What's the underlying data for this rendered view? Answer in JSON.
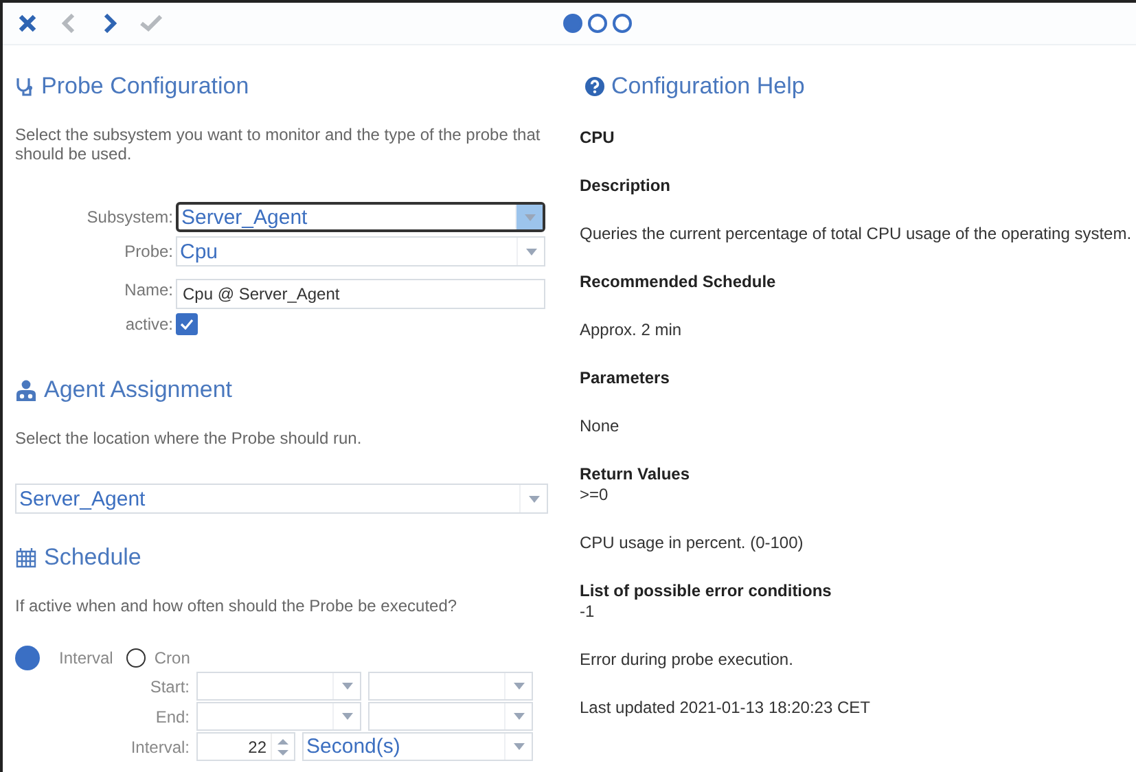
{
  "toolbar": [
    {
      "kind": "close",
      "disabled": false
    },
    {
      "kind": "back",
      "disabled": true
    },
    {
      "kind": "forward",
      "disabled": false
    },
    {
      "kind": "finish",
      "disabled": true
    }
  ],
  "steps": [
    {
      "selected": true
    },
    {
      "selected": false
    },
    {
      "selected": false
    }
  ],
  "probe_configuration": {
    "title": "Probe Configuration",
    "description": "Select the subsystem you want to monitor and the type of the probe that should be used.",
    "fields": [
      {
        "kind": "select",
        "label": "Subsystem:",
        "value": "Server_Agent",
        "focused": true
      },
      {
        "kind": "select",
        "label": "Probe:",
        "value": "Cpu",
        "focused": false
      },
      {
        "kind": "text",
        "label": "Name:",
        "value": "Cpu @ Server_Agent"
      },
      {
        "kind": "checkbox",
        "label": "active:",
        "checked": true
      }
    ]
  },
  "agent_assignment": {
    "title": "Agent Assignment",
    "description": "Select the location where the Probe should run.",
    "value": "Server_Agent"
  },
  "schedule": {
    "title": "Schedule",
    "description": "If active when and how often should the Probe be executed?",
    "modes": [
      {
        "label": "Interval",
        "selected": true
      },
      {
        "label": "Cron",
        "selected": false
      }
    ],
    "rows": [
      {
        "kind": "range",
        "label": "Start:"
      },
      {
        "kind": "range",
        "label": "End:"
      },
      {
        "kind": "interval",
        "label": "Interval:",
        "value": "22",
        "unit": "Second(s)"
      }
    ]
  },
  "help": {
    "title": "Configuration Help",
    "items": [
      {
        "kind": "heading",
        "text": "CPU"
      },
      {
        "kind": "heading",
        "text": "Description"
      },
      {
        "kind": "text",
        "text": "Queries the current percentage of total CPU usage of the operating system."
      },
      {
        "kind": "heading",
        "text": "Recommended Schedule"
      },
      {
        "kind": "text",
        "text": "Approx. 2 min"
      },
      {
        "kind": "heading",
        "text": "Parameters"
      },
      {
        "kind": "text",
        "text": "None"
      },
      {
        "kind": "heading",
        "text": "Return Values"
      },
      {
        "kind": "value",
        "text": ">=0"
      },
      {
        "kind": "text",
        "text": "CPU usage in percent. (0-100)"
      },
      {
        "kind": "heading",
        "text": "List of possible error conditions"
      },
      {
        "kind": "value",
        "text": "-1"
      },
      {
        "kind": "text",
        "text": "Error during probe execution."
      },
      {
        "kind": "text",
        "text": "Last updated 2021-01-13 18:20:23 CET"
      }
    ]
  }
}
